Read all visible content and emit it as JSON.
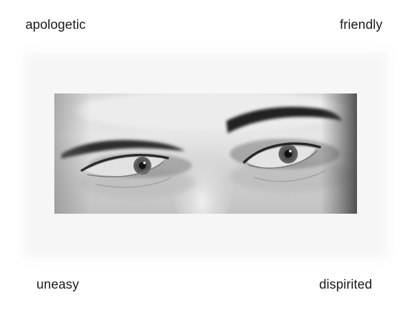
{
  "labels": {
    "top_left": "apologetic",
    "top_right": "friendly",
    "bottom_left": "uneasy",
    "bottom_right": "dispirited"
  },
  "photo": {
    "subject": "grayscale close-up of a man's eyes",
    "colors": {
      "skin_light": "#e4e4e4",
      "skin_mid": "#bdbdbd",
      "shadow": "#6e6e6e",
      "brow": "#2a2a2a",
      "iris": "#4a4a4a"
    }
  }
}
